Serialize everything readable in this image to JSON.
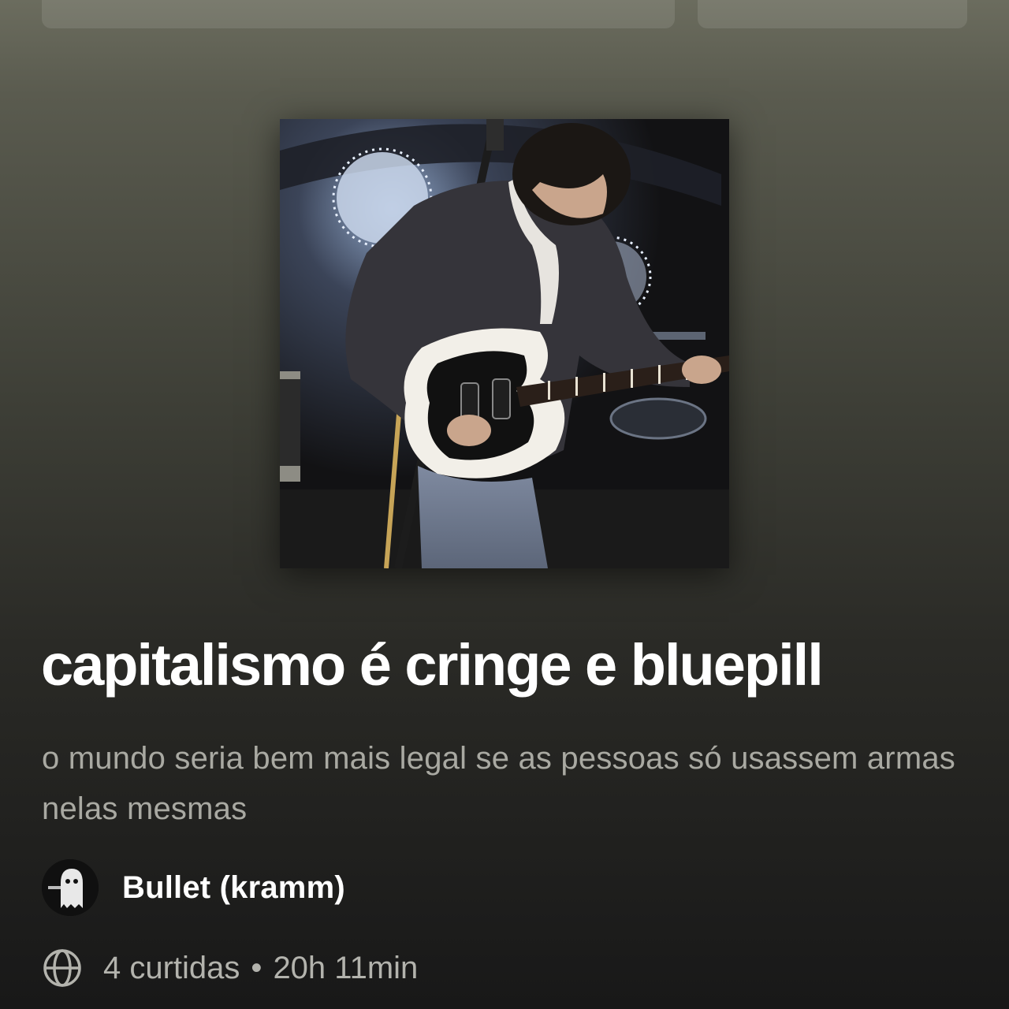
{
  "playlist": {
    "title": "capitalismo é cringe e bluepill",
    "description": "o mundo seria bem mais legal se as pessoas só usassem armas nelas mesmas",
    "owner": {
      "name": "Bullet (kramm)",
      "avatar_icon": "ghost-avatar"
    },
    "meta": {
      "visibility_icon": "globe-icon",
      "likes": "4 curtidas",
      "separator": "•",
      "duration": "20h 11min"
    },
    "cover_image": "guitarist-on-stage-photo"
  },
  "colors": {
    "background_top": "#6b6c5e",
    "background_bottom": "#181818",
    "description_text": "#a9a9a2",
    "meta_text": "#b3b3ad"
  }
}
